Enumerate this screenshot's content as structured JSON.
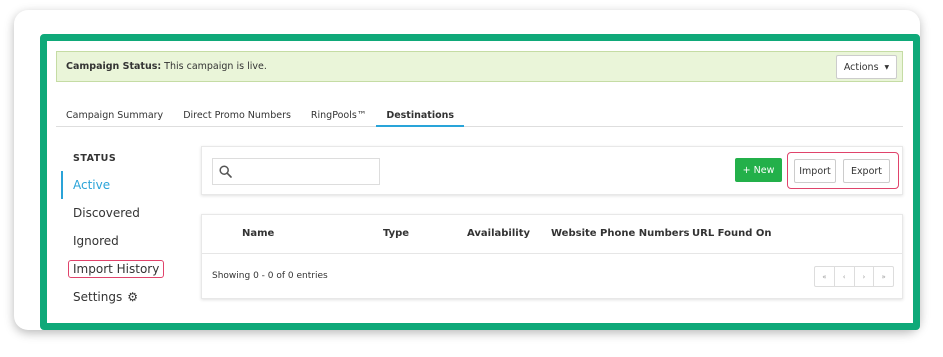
{
  "banner": {
    "label": "Campaign Status:",
    "text": "This campaign is live.",
    "actions_label": "Actions",
    "actions_caret": "▼"
  },
  "tabs": [
    {
      "label": "Campaign Summary",
      "active": false
    },
    {
      "label": "Direct Promo Numbers",
      "active": false
    },
    {
      "label": "RingPools™",
      "active": false
    },
    {
      "label": "Destinations",
      "active": true
    }
  ],
  "sidebar": {
    "heading": "STATUS",
    "items": [
      {
        "label": "Active",
        "active": true
      },
      {
        "label": "Discovered",
        "active": false
      },
      {
        "label": "Ignored",
        "active": false
      },
      {
        "label": "Import History",
        "highlighted": true
      },
      {
        "label": "Settings",
        "icon": "gear-icon"
      }
    ]
  },
  "toolbar": {
    "search_icon": "search-icon",
    "search_value": "",
    "new_label": "+ New",
    "import_label": "Import",
    "export_label": "Export"
  },
  "table": {
    "columns": [
      "Name",
      "Type",
      "Availability",
      "Website Phone Numbers",
      "URL Found On"
    ],
    "rows": [],
    "showing_text": "Showing 0 - 0 of 0 entries",
    "pager": [
      "«",
      "‹",
      "›",
      "»"
    ]
  },
  "colors": {
    "frame": "#0fa979",
    "banner_bg": "#eaf5d9",
    "accent": "#2aa3d8",
    "new_button": "#23b04a",
    "highlight_outline": "#e0436b"
  }
}
